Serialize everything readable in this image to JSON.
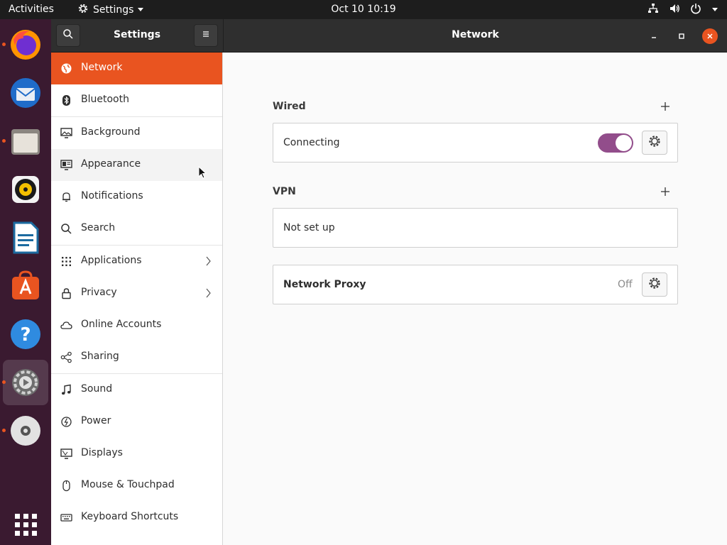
{
  "topbar": {
    "activities": "Activities",
    "app_menu": "Settings",
    "clock": "Oct 10  10:19"
  },
  "dock": {
    "items": [
      "firefox-icon",
      "thunderbird-icon",
      "files-icon",
      "rhythmbox-icon",
      "libreoffice-writer-icon",
      "software-icon",
      "help-icon",
      "settings-icon",
      "dvd-icon",
      "show-apps-icon"
    ]
  },
  "window": {
    "sidebar_title": "Settings",
    "page_title": "Network"
  },
  "sidebar": {
    "items": [
      {
        "label": "Network",
        "icon": "network-icon"
      },
      {
        "label": "Bluetooth",
        "icon": "bluetooth-icon"
      },
      {
        "label": "Background",
        "icon": "background-icon"
      },
      {
        "label": "Appearance",
        "icon": "appearance-icon"
      },
      {
        "label": "Notifications",
        "icon": "bell-icon"
      },
      {
        "label": "Search",
        "icon": "search-icon"
      },
      {
        "label": "Applications",
        "icon": "grid-icon"
      },
      {
        "label": "Privacy",
        "icon": "lock-icon"
      },
      {
        "label": "Online Accounts",
        "icon": "cloud-icon"
      },
      {
        "label": "Sharing",
        "icon": "share-icon"
      },
      {
        "label": "Sound",
        "icon": "music-note-icon"
      },
      {
        "label": "Power",
        "icon": "power-icon"
      },
      {
        "label": "Displays",
        "icon": "display-icon"
      },
      {
        "label": "Mouse & Touchpad",
        "icon": "mouse-icon"
      },
      {
        "label": "Keyboard Shortcuts",
        "icon": "keyboard-icon"
      }
    ]
  },
  "network": {
    "wired": {
      "title": "Wired",
      "status": "Connecting",
      "enabled": true
    },
    "vpn": {
      "title": "VPN",
      "status": "Not set up"
    },
    "proxy": {
      "label": "Network Proxy",
      "status": "Off"
    }
  },
  "colors": {
    "accent": "#e95420",
    "toggle_on": "#924d8b",
    "headerbar": "#2f2f2f"
  }
}
